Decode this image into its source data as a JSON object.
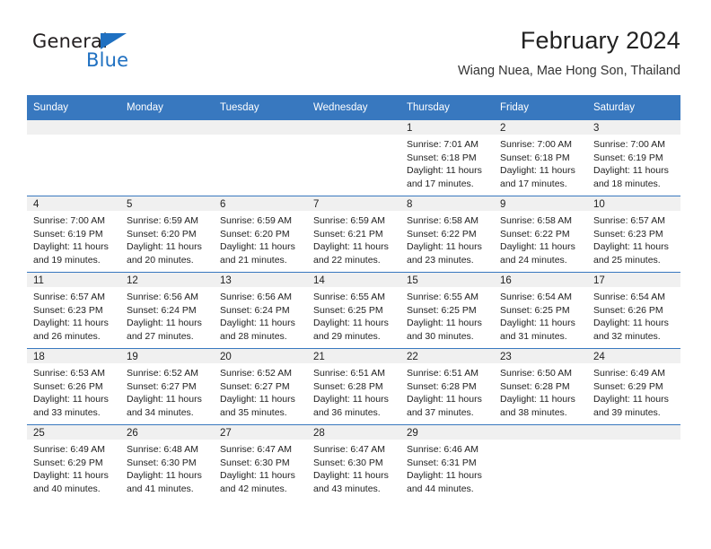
{
  "brand": {
    "word1": "General",
    "word2": "Blue",
    "triangle_color": "#1f70c1",
    "text_color": "#231f20"
  },
  "header": {
    "title": "February 2024",
    "subtitle": "Wiang Nuea, Mae Hong Son, Thailand"
  },
  "theme": {
    "header_bg": "#3878bf",
    "header_text": "#ffffff",
    "daynum_band_bg": "#f0f0f0",
    "cell_bg": "#ffffff",
    "grid_line": "#3878bf"
  },
  "weekday_headers": [
    "Sunday",
    "Monday",
    "Tuesday",
    "Wednesday",
    "Thursday",
    "Friday",
    "Saturday"
  ],
  "weeks": [
    [
      {
        "day": "",
        "empty": true,
        "sunrise": "",
        "sunset": "",
        "daylight1": "",
        "daylight2": ""
      },
      {
        "day": "",
        "empty": true,
        "sunrise": "",
        "sunset": "",
        "daylight1": "",
        "daylight2": ""
      },
      {
        "day": "",
        "empty": true,
        "sunrise": "",
        "sunset": "",
        "daylight1": "",
        "daylight2": ""
      },
      {
        "day": "",
        "empty": true,
        "sunrise": "",
        "sunset": "",
        "daylight1": "",
        "daylight2": ""
      },
      {
        "day": "1",
        "empty": false,
        "sunrise": "Sunrise: 7:01 AM",
        "sunset": "Sunset: 6:18 PM",
        "daylight1": "Daylight: 11 hours",
        "daylight2": "and 17 minutes."
      },
      {
        "day": "2",
        "empty": false,
        "sunrise": "Sunrise: 7:00 AM",
        "sunset": "Sunset: 6:18 PM",
        "daylight1": "Daylight: 11 hours",
        "daylight2": "and 17 minutes."
      },
      {
        "day": "3",
        "empty": false,
        "sunrise": "Sunrise: 7:00 AM",
        "sunset": "Sunset: 6:19 PM",
        "daylight1": "Daylight: 11 hours",
        "daylight2": "and 18 minutes."
      }
    ],
    [
      {
        "day": "4",
        "empty": false,
        "sunrise": "Sunrise: 7:00 AM",
        "sunset": "Sunset: 6:19 PM",
        "daylight1": "Daylight: 11 hours",
        "daylight2": "and 19 minutes."
      },
      {
        "day": "5",
        "empty": false,
        "sunrise": "Sunrise: 6:59 AM",
        "sunset": "Sunset: 6:20 PM",
        "daylight1": "Daylight: 11 hours",
        "daylight2": "and 20 minutes."
      },
      {
        "day": "6",
        "empty": false,
        "sunrise": "Sunrise: 6:59 AM",
        "sunset": "Sunset: 6:20 PM",
        "daylight1": "Daylight: 11 hours",
        "daylight2": "and 21 minutes."
      },
      {
        "day": "7",
        "empty": false,
        "sunrise": "Sunrise: 6:59 AM",
        "sunset": "Sunset: 6:21 PM",
        "daylight1": "Daylight: 11 hours",
        "daylight2": "and 22 minutes."
      },
      {
        "day": "8",
        "empty": false,
        "sunrise": "Sunrise: 6:58 AM",
        "sunset": "Sunset: 6:22 PM",
        "daylight1": "Daylight: 11 hours",
        "daylight2": "and 23 minutes."
      },
      {
        "day": "9",
        "empty": false,
        "sunrise": "Sunrise: 6:58 AM",
        "sunset": "Sunset: 6:22 PM",
        "daylight1": "Daylight: 11 hours",
        "daylight2": "and 24 minutes."
      },
      {
        "day": "10",
        "empty": false,
        "sunrise": "Sunrise: 6:57 AM",
        "sunset": "Sunset: 6:23 PM",
        "daylight1": "Daylight: 11 hours",
        "daylight2": "and 25 minutes."
      }
    ],
    [
      {
        "day": "11",
        "empty": false,
        "sunrise": "Sunrise: 6:57 AM",
        "sunset": "Sunset: 6:23 PM",
        "daylight1": "Daylight: 11 hours",
        "daylight2": "and 26 minutes."
      },
      {
        "day": "12",
        "empty": false,
        "sunrise": "Sunrise: 6:56 AM",
        "sunset": "Sunset: 6:24 PM",
        "daylight1": "Daylight: 11 hours",
        "daylight2": "and 27 minutes."
      },
      {
        "day": "13",
        "empty": false,
        "sunrise": "Sunrise: 6:56 AM",
        "sunset": "Sunset: 6:24 PM",
        "daylight1": "Daylight: 11 hours",
        "daylight2": "and 28 minutes."
      },
      {
        "day": "14",
        "empty": false,
        "sunrise": "Sunrise: 6:55 AM",
        "sunset": "Sunset: 6:25 PM",
        "daylight1": "Daylight: 11 hours",
        "daylight2": "and 29 minutes."
      },
      {
        "day": "15",
        "empty": false,
        "sunrise": "Sunrise: 6:55 AM",
        "sunset": "Sunset: 6:25 PM",
        "daylight1": "Daylight: 11 hours",
        "daylight2": "and 30 minutes."
      },
      {
        "day": "16",
        "empty": false,
        "sunrise": "Sunrise: 6:54 AM",
        "sunset": "Sunset: 6:25 PM",
        "daylight1": "Daylight: 11 hours",
        "daylight2": "and 31 minutes."
      },
      {
        "day": "17",
        "empty": false,
        "sunrise": "Sunrise: 6:54 AM",
        "sunset": "Sunset: 6:26 PM",
        "daylight1": "Daylight: 11 hours",
        "daylight2": "and 32 minutes."
      }
    ],
    [
      {
        "day": "18",
        "empty": false,
        "sunrise": "Sunrise: 6:53 AM",
        "sunset": "Sunset: 6:26 PM",
        "daylight1": "Daylight: 11 hours",
        "daylight2": "and 33 minutes."
      },
      {
        "day": "19",
        "empty": false,
        "sunrise": "Sunrise: 6:52 AM",
        "sunset": "Sunset: 6:27 PM",
        "daylight1": "Daylight: 11 hours",
        "daylight2": "and 34 minutes."
      },
      {
        "day": "20",
        "empty": false,
        "sunrise": "Sunrise: 6:52 AM",
        "sunset": "Sunset: 6:27 PM",
        "daylight1": "Daylight: 11 hours",
        "daylight2": "and 35 minutes."
      },
      {
        "day": "21",
        "empty": false,
        "sunrise": "Sunrise: 6:51 AM",
        "sunset": "Sunset: 6:28 PM",
        "daylight1": "Daylight: 11 hours",
        "daylight2": "and 36 minutes."
      },
      {
        "day": "22",
        "empty": false,
        "sunrise": "Sunrise: 6:51 AM",
        "sunset": "Sunset: 6:28 PM",
        "daylight1": "Daylight: 11 hours",
        "daylight2": "and 37 minutes."
      },
      {
        "day": "23",
        "empty": false,
        "sunrise": "Sunrise: 6:50 AM",
        "sunset": "Sunset: 6:28 PM",
        "daylight1": "Daylight: 11 hours",
        "daylight2": "and 38 minutes."
      },
      {
        "day": "24",
        "empty": false,
        "sunrise": "Sunrise: 6:49 AM",
        "sunset": "Sunset: 6:29 PM",
        "daylight1": "Daylight: 11 hours",
        "daylight2": "and 39 minutes."
      }
    ],
    [
      {
        "day": "25",
        "empty": false,
        "sunrise": "Sunrise: 6:49 AM",
        "sunset": "Sunset: 6:29 PM",
        "daylight1": "Daylight: 11 hours",
        "daylight2": "and 40 minutes."
      },
      {
        "day": "26",
        "empty": false,
        "sunrise": "Sunrise: 6:48 AM",
        "sunset": "Sunset: 6:30 PM",
        "daylight1": "Daylight: 11 hours",
        "daylight2": "and 41 minutes."
      },
      {
        "day": "27",
        "empty": false,
        "sunrise": "Sunrise: 6:47 AM",
        "sunset": "Sunset: 6:30 PM",
        "daylight1": "Daylight: 11 hours",
        "daylight2": "and 42 minutes."
      },
      {
        "day": "28",
        "empty": false,
        "sunrise": "Sunrise: 6:47 AM",
        "sunset": "Sunset: 6:30 PM",
        "daylight1": "Daylight: 11 hours",
        "daylight2": "and 43 minutes."
      },
      {
        "day": "29",
        "empty": false,
        "sunrise": "Sunrise: 6:46 AM",
        "sunset": "Sunset: 6:31 PM",
        "daylight1": "Daylight: 11 hours",
        "daylight2": "and 44 minutes."
      },
      {
        "day": "",
        "empty": true,
        "sunrise": "",
        "sunset": "",
        "daylight1": "",
        "daylight2": ""
      },
      {
        "day": "",
        "empty": true,
        "sunrise": "",
        "sunset": "",
        "daylight1": "",
        "daylight2": ""
      }
    ]
  ]
}
